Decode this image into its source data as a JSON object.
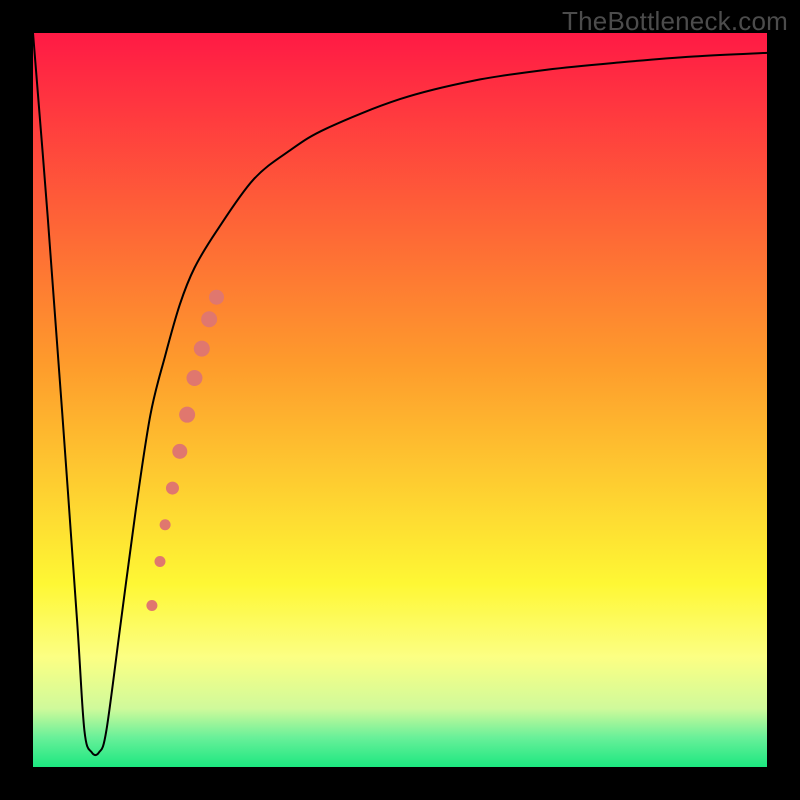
{
  "watermark": "TheBottleneck.com",
  "chart_data": {
    "type": "line",
    "title": "",
    "xlabel": "",
    "ylabel": "",
    "xlim": [
      0,
      100
    ],
    "ylim": [
      0,
      100
    ],
    "background_gradient": {
      "direction": "top-to-bottom",
      "stops": [
        {
          "pos": 0,
          "color": "#ff1a45"
        },
        {
          "pos": 45,
          "color": "#fe9b2c"
        },
        {
          "pos": 75,
          "color": "#fef734"
        },
        {
          "pos": 85,
          "color": "#fcff83"
        },
        {
          "pos": 92,
          "color": "#d0fa9b"
        },
        {
          "pos": 96,
          "color": "#68f099"
        },
        {
          "pos": 100,
          "color": "#1ce780"
        }
      ]
    },
    "series": [
      {
        "name": "bottleneck-curve",
        "color": "#000000",
        "stroke_width": 2,
        "x": [
          0,
          2,
          4,
          6,
          7,
          8,
          9,
          10,
          12,
          14,
          16,
          18,
          20,
          22,
          25,
          30,
          35,
          40,
          50,
          60,
          70,
          80,
          90,
          100
        ],
        "y": [
          100,
          75,
          48,
          20,
          5,
          2,
          2,
          5,
          20,
          35,
          48,
          56,
          63,
          68,
          73,
          80,
          84,
          87,
          91,
          93.5,
          95,
          96,
          96.8,
          97.3
        ]
      }
    ],
    "markers": {
      "name": "highlight-points",
      "color": "#e0776e",
      "points": [
        {
          "x": 16.2,
          "y": 22,
          "r": 5.5
        },
        {
          "x": 17.3,
          "y": 28,
          "r": 5.5
        },
        {
          "x": 18.0,
          "y": 33,
          "r": 5.5
        },
        {
          "x": 19.0,
          "y": 38,
          "r": 6.5
        },
        {
          "x": 20.0,
          "y": 43,
          "r": 7.5
        },
        {
          "x": 21.0,
          "y": 48,
          "r": 8.0
        },
        {
          "x": 22.0,
          "y": 53,
          "r": 8.0
        },
        {
          "x": 23.0,
          "y": 57,
          "r": 8.0
        },
        {
          "x": 24.0,
          "y": 61,
          "r": 8.0
        },
        {
          "x": 25.0,
          "y": 64,
          "r": 7.5
        }
      ]
    }
  }
}
